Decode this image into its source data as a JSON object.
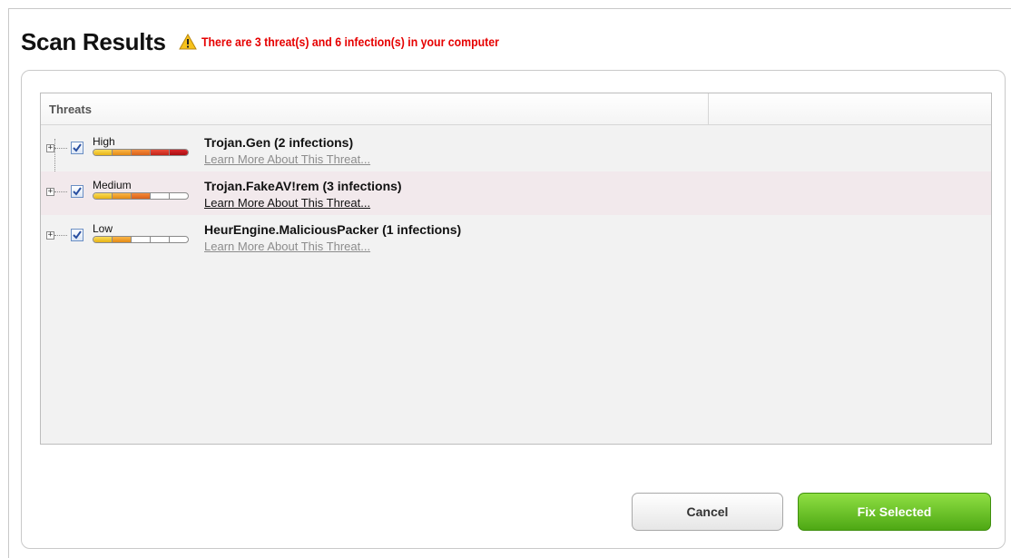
{
  "header": {
    "title": "Scan Results",
    "warning_icon": "warning-triangle-icon",
    "warning_text": "There are 3 threat(s) and 6 infection(s) in your computer",
    "warning_color": "#e60000"
  },
  "table": {
    "column_header": "Threats",
    "rows": [
      {
        "checked": true,
        "severity": "High",
        "severity_level_segments": 5,
        "threat": "Trojan.Gen (2 infections)",
        "link": "Learn More About This Threat..."
      },
      {
        "checked": true,
        "severity": "Medium",
        "severity_level_segments": 3,
        "threat": "Trojan.FakeAV!rem (3 infections)",
        "link": "Learn More About This Threat..."
      },
      {
        "checked": true,
        "severity": "Low",
        "severity_level_segments": 2,
        "threat": "HeurEngine.MaliciousPacker (1 infections)",
        "link": "Learn More About This Threat..."
      }
    ]
  },
  "buttons": {
    "cancel": "Cancel",
    "fix": "Fix Selected"
  },
  "colors": {
    "fix_button": "#5cb81d",
    "severity_high": "#c0141a",
    "severity_medium": "#e8761c",
    "severity_low": "#f2b81a"
  }
}
